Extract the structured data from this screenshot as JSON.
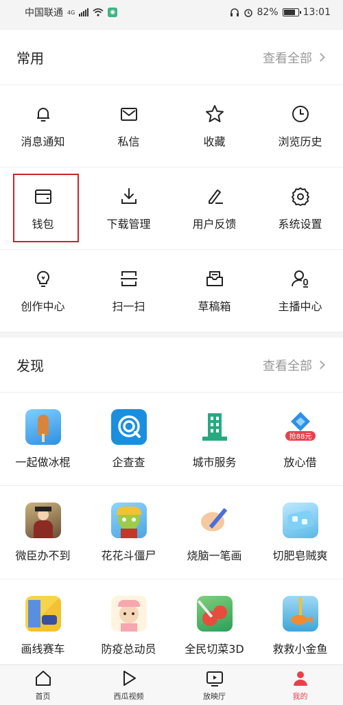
{
  "status_bar": {
    "carrier": "中国联通",
    "network": "4G",
    "battery": "82%",
    "time": "13:01"
  },
  "common": {
    "title": "常用",
    "see_all": "查看全部",
    "items": [
      {
        "label": "消息通知",
        "icon": "bell-icon"
      },
      {
        "label": "私信",
        "icon": "envelope-icon"
      },
      {
        "label": "收藏",
        "icon": "star-icon"
      },
      {
        "label": "浏览历史",
        "icon": "clock-icon"
      },
      {
        "label": "钱包",
        "icon": "wallet-icon"
      },
      {
        "label": "下载管理",
        "icon": "download-icon"
      },
      {
        "label": "用户反馈",
        "icon": "pen-icon"
      },
      {
        "label": "系统设置",
        "icon": "gear-icon"
      },
      {
        "label": "创作中心",
        "icon": "lightbulb-icon"
      },
      {
        "label": "扫一扫",
        "icon": "scan-icon"
      },
      {
        "label": "草稿箱",
        "icon": "drafts-icon"
      },
      {
        "label": "主播中心",
        "icon": "streamer-icon"
      }
    ]
  },
  "discover": {
    "title": "发现",
    "see_all": "查看全部",
    "items": [
      {
        "label": "一起做冰棍",
        "icon": "popsicle-game-icon",
        "color": "#3aa3e8"
      },
      {
        "label": "企查查",
        "icon": "qichacha-icon",
        "color": "#1a8fe0"
      },
      {
        "label": "城市服务",
        "icon": "city-building-icon",
        "color": "#2aa87f"
      },
      {
        "label": "放心借",
        "icon": "loan-icon",
        "color": "#e8414b",
        "badge": "抢88元"
      },
      {
        "label": "微臣办不到",
        "icon": "minister-game-icon",
        "color": "#6b4e3a"
      },
      {
        "label": "花花斗僵尸",
        "icon": "zombie-game-icon",
        "color": "#8bc34a"
      },
      {
        "label": "烧脑一笔画",
        "icon": "brain-drawing-icon",
        "color": "#f5c9a0"
      },
      {
        "label": "切肥皂贼爽",
        "icon": "soap-cutting-icon",
        "color": "#5ab8e6"
      },
      {
        "label": "画线赛车",
        "icon": "racing-game-icon",
        "color": "#f2c230"
      },
      {
        "label": "防疫总动员",
        "icon": "nurse-game-icon",
        "color": "#f6a7b0"
      },
      {
        "label": "全民切菜3D",
        "icon": "vegetable-cutting-icon",
        "color": "#e84c3d"
      },
      {
        "label": "救救小金鱼",
        "icon": "goldfish-game-icon",
        "color": "#3fa6d8"
      }
    ]
  },
  "tabbar": {
    "items": [
      {
        "label": "首页",
        "icon": "home-icon"
      },
      {
        "label": "西瓜视频",
        "icon": "play-icon"
      },
      {
        "label": "放映厅",
        "icon": "tv-icon"
      },
      {
        "label": "我的",
        "icon": "profile-icon",
        "active": true
      }
    ]
  }
}
